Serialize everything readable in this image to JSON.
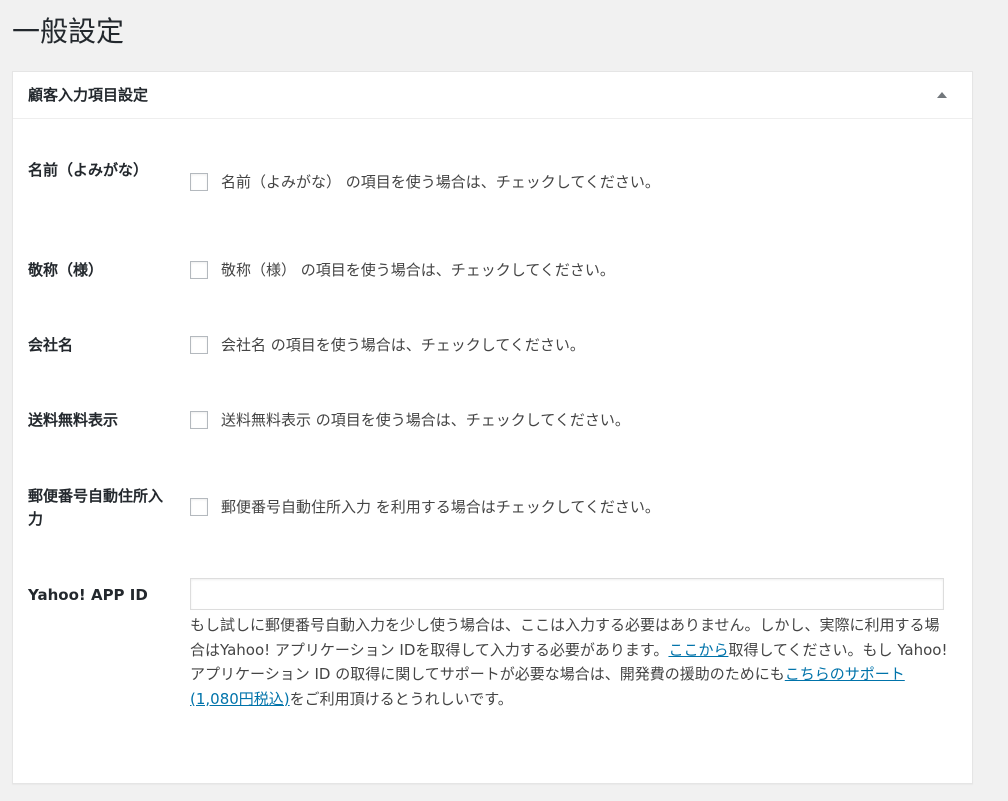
{
  "page": {
    "title": "一般設定"
  },
  "section": {
    "title": "顧客入力項目設定"
  },
  "fields": [
    {
      "label": "名前（よみがな）",
      "checkbox_label": "名前（よみがな） の項目を使う場合は、チェックしてください。",
      "checked": false
    },
    {
      "label": "敬称（様）",
      "checkbox_label": "敬称（様） の項目を使う場合は、チェックしてください。",
      "checked": false
    },
    {
      "label": "会社名",
      "checkbox_label": "会社名 の項目を使う場合は、チェックしてください。",
      "checked": false
    },
    {
      "label": "送料無料表示",
      "checkbox_label": "送料無料表示 の項目を使う場合は、チェックしてください。",
      "checked": false
    },
    {
      "label": "郵便番号自動住所入力",
      "checkbox_label": "郵便番号自動住所入力 を利用する場合はチェックしてください。",
      "checked": false
    }
  ],
  "yahoo": {
    "label": "Yahoo! APP ID",
    "value": "",
    "placeholder": "",
    "description": {
      "text_1": "もし試しに郵便番号自動入力を少し使う場合は、ここは入力する必要はありません。しかし、実際に利用する場合はYahoo! アプリケーション IDを取得して入力する必要があります。",
      "link_1": "ここから",
      "text_2": "取得してください。もし Yahoo! アプリケーション ID の取得に関してサポートが必要な場合は、開発費の援助のためにも",
      "link_2": "こちらのサポート(1,080円税込)",
      "text_3": "をご利用頂けるとうれしいです。"
    }
  },
  "icons": {
    "toggle": "triangle-up-icon"
  },
  "colors": {
    "background": "#f1f1f1",
    "panel": "#ffffff",
    "border": "#e5e5e5",
    "link": "#0073aa",
    "text": "#23282d"
  }
}
